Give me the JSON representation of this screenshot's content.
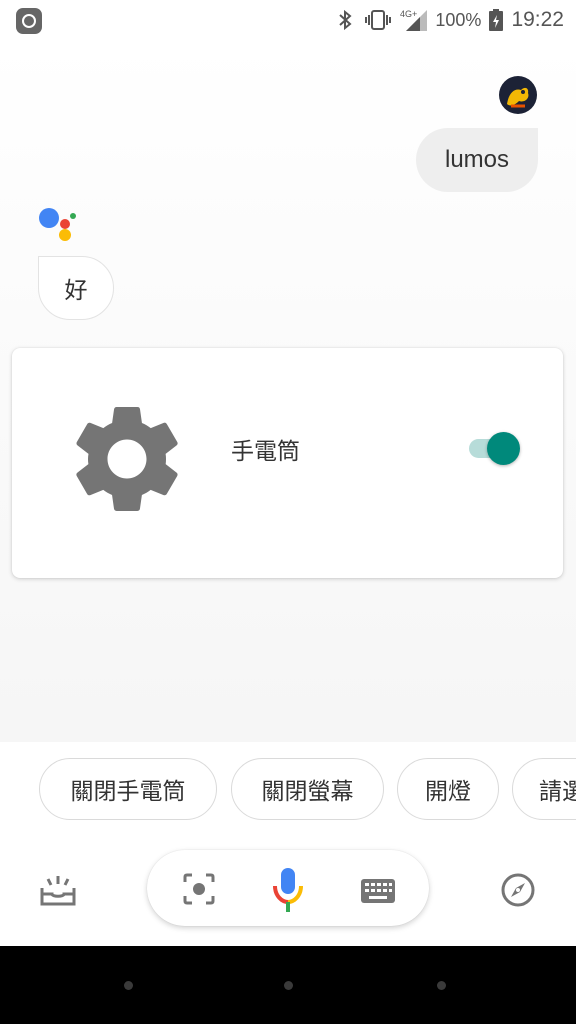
{
  "status_bar": {
    "network_label": "4G+",
    "battery_text": "100%",
    "time": "19:22",
    "icons": [
      "app-icon",
      "bluetooth-icon",
      "vibrate-icon",
      "signal-icon",
      "battery-icon"
    ]
  },
  "conversation": {
    "user_message": "lumos",
    "assistant_reply": "好",
    "card": {
      "title": "手電筒",
      "toggle_on": true,
      "icon": "gear-icon"
    }
  },
  "suggestions": [
    "關閉手電筒",
    "關閉螢幕",
    "開燈",
    "請選"
  ],
  "toolbar": {
    "icons": [
      "updates-icon",
      "lens-icon",
      "microphone-icon",
      "keyboard-icon",
      "explore-icon"
    ]
  },
  "colors": {
    "accent_teal": "#00897b",
    "google_blue": "#4285f4",
    "google_red": "#ea4335",
    "google_yellow": "#fbbc05",
    "google_green": "#34a853",
    "icon_gray": "#757575"
  }
}
